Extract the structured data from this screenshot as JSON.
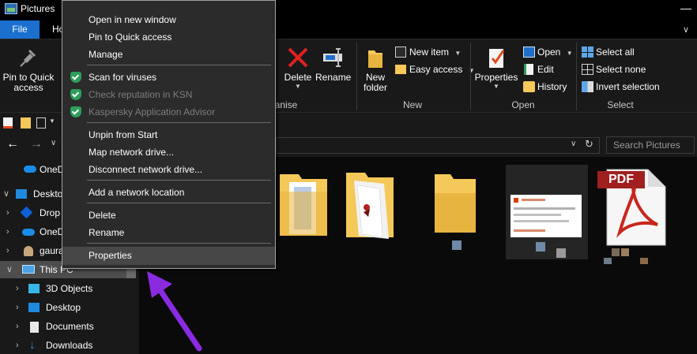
{
  "window": {
    "title": "Pictures"
  },
  "tabs": {
    "file": "File",
    "home": "Ho"
  },
  "ribbon": {
    "pin_label_line1": "Pin to Quick",
    "pin_label_line2": "access",
    "organise_group": "anise",
    "delete_label": "Delete",
    "rename_label": "Rename",
    "new_folder_line1": "New",
    "new_folder_line2": "folder",
    "new_item_label": "New item",
    "easy_access_label": "Easy access",
    "new_group": "New",
    "properties_label": "Properties",
    "open_label": "Open",
    "edit_label": "Edit",
    "history_label": "History",
    "open_group": "Open",
    "select_all_label": "Select all",
    "select_none_label": "Select none",
    "invert_selection_label": "Invert selection",
    "select_group": "Select"
  },
  "search": {
    "placeholder": "Search Pictures"
  },
  "nav": {
    "items": [
      {
        "label": "OneD",
        "icon": "onedrive-icon"
      },
      {
        "label": "Deskto",
        "icon": "desktop-icon"
      },
      {
        "label": "Drop",
        "icon": "dropbox-icon"
      },
      {
        "label": "OneD",
        "icon": "onedrive-icon"
      },
      {
        "label": "gaura",
        "icon": "user-icon"
      },
      {
        "label": "This PC",
        "icon": "computer-icon"
      },
      {
        "label": "3D Objects",
        "icon": "3d-objects-icon"
      },
      {
        "label": "Desktop",
        "icon": "desktop-icon"
      },
      {
        "label": "Documents",
        "icon": "documents-icon"
      },
      {
        "label": "Downloads",
        "icon": "downloads-icon"
      }
    ]
  },
  "context_menu": {
    "items": [
      {
        "label": "Open in new window"
      },
      {
        "label": "Pin to Quick access"
      },
      {
        "label": "Manage"
      },
      {
        "label": "Scan for viruses"
      },
      {
        "label": "Check reputation in KSN"
      },
      {
        "label": "Kaspersky Application Advisor"
      },
      {
        "label": "Unpin from Start"
      },
      {
        "label": "Map network drive..."
      },
      {
        "label": "Disconnect network drive..."
      },
      {
        "label": "Add a network location"
      },
      {
        "label": "Delete"
      },
      {
        "label": "Rename"
      },
      {
        "label": "Properties"
      }
    ]
  },
  "files": {
    "pdf_badge": "PDF"
  },
  "colors": {
    "accent": "#1a6fcf",
    "arrow": "#8a2be2",
    "folder": "#f5c85a",
    "kaspersky_green": "#2e9e5b"
  }
}
